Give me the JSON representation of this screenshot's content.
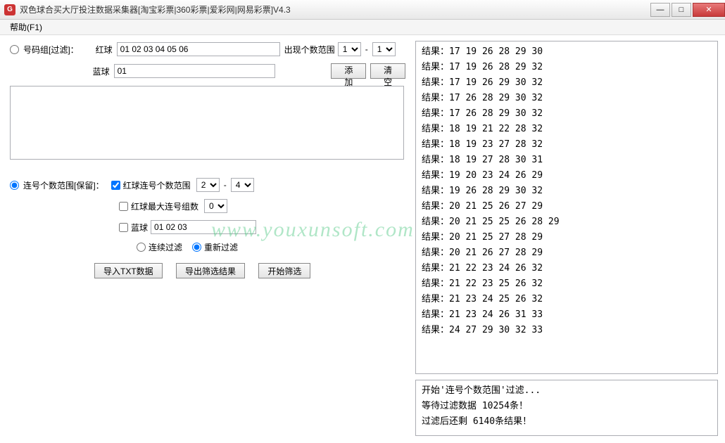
{
  "window": {
    "title": "双色球合买大厅投注数据采集器[淘宝彩票|360彩票|爱彩网|网易彩票]V4.3",
    "icon_letter": "G"
  },
  "menu": {
    "help": "帮助(F1)"
  },
  "filter1": {
    "group_label": "号码组[过滤]：",
    "red_label": "红球",
    "red_value": "01 02 03 04 05 06",
    "range_label": "出现个数范围",
    "range_from": "1",
    "range_to": "1",
    "blue_label": "蓝球",
    "blue_value": "01",
    "add_btn": "添加",
    "clear_btn": "清空"
  },
  "filter2": {
    "group_label": "连号个数范围[保留]：",
    "red_range_chk": "红球连号个数范围",
    "red_range_from": "2",
    "red_range_to": "4",
    "max_group_chk": "红球最大连号组数",
    "max_group_val": "0",
    "blue_chk": "蓝球",
    "blue_value": "01 02 03",
    "mode_continuous": "连续过滤",
    "mode_restart": "重新过滤"
  },
  "actions": {
    "import": "导入TXT数据",
    "export": "导出筛选结果",
    "start": "开始筛选"
  },
  "results_prefix": "结果：",
  "results": [
    "17 19 26 28 29 30",
    "17 19 26 28 29 32",
    "17 19 26 29 30 32",
    "17 26 28 29 30 32",
    "17 26 28 29 30 32",
    "18 19 21 22 28 32",
    "18 19 23 27 28 32",
    "18 19 27 28 30 31",
    "19 20 23 24 26 29",
    "19 26 28 29 30 32",
    "20 21 25 26 27 29",
    "20 21 25 25 26 28 29",
    "20 21 25 27 28 29",
    "20 21 26 27 28 29",
    "21 22 23 24 26 32",
    "21 22 23 25 26 32",
    "21 23 24 25 26 32",
    "21 23 24 26 31 33",
    "24 27 29 30 32 33"
  ],
  "log": {
    "l1": "开始'连号个数范围'过滤...",
    "l2": "等待过滤数据 10254条！",
    "l3": "过滤后还剩 6140条结果！"
  },
  "watermark": "www.youxunsoft.com"
}
